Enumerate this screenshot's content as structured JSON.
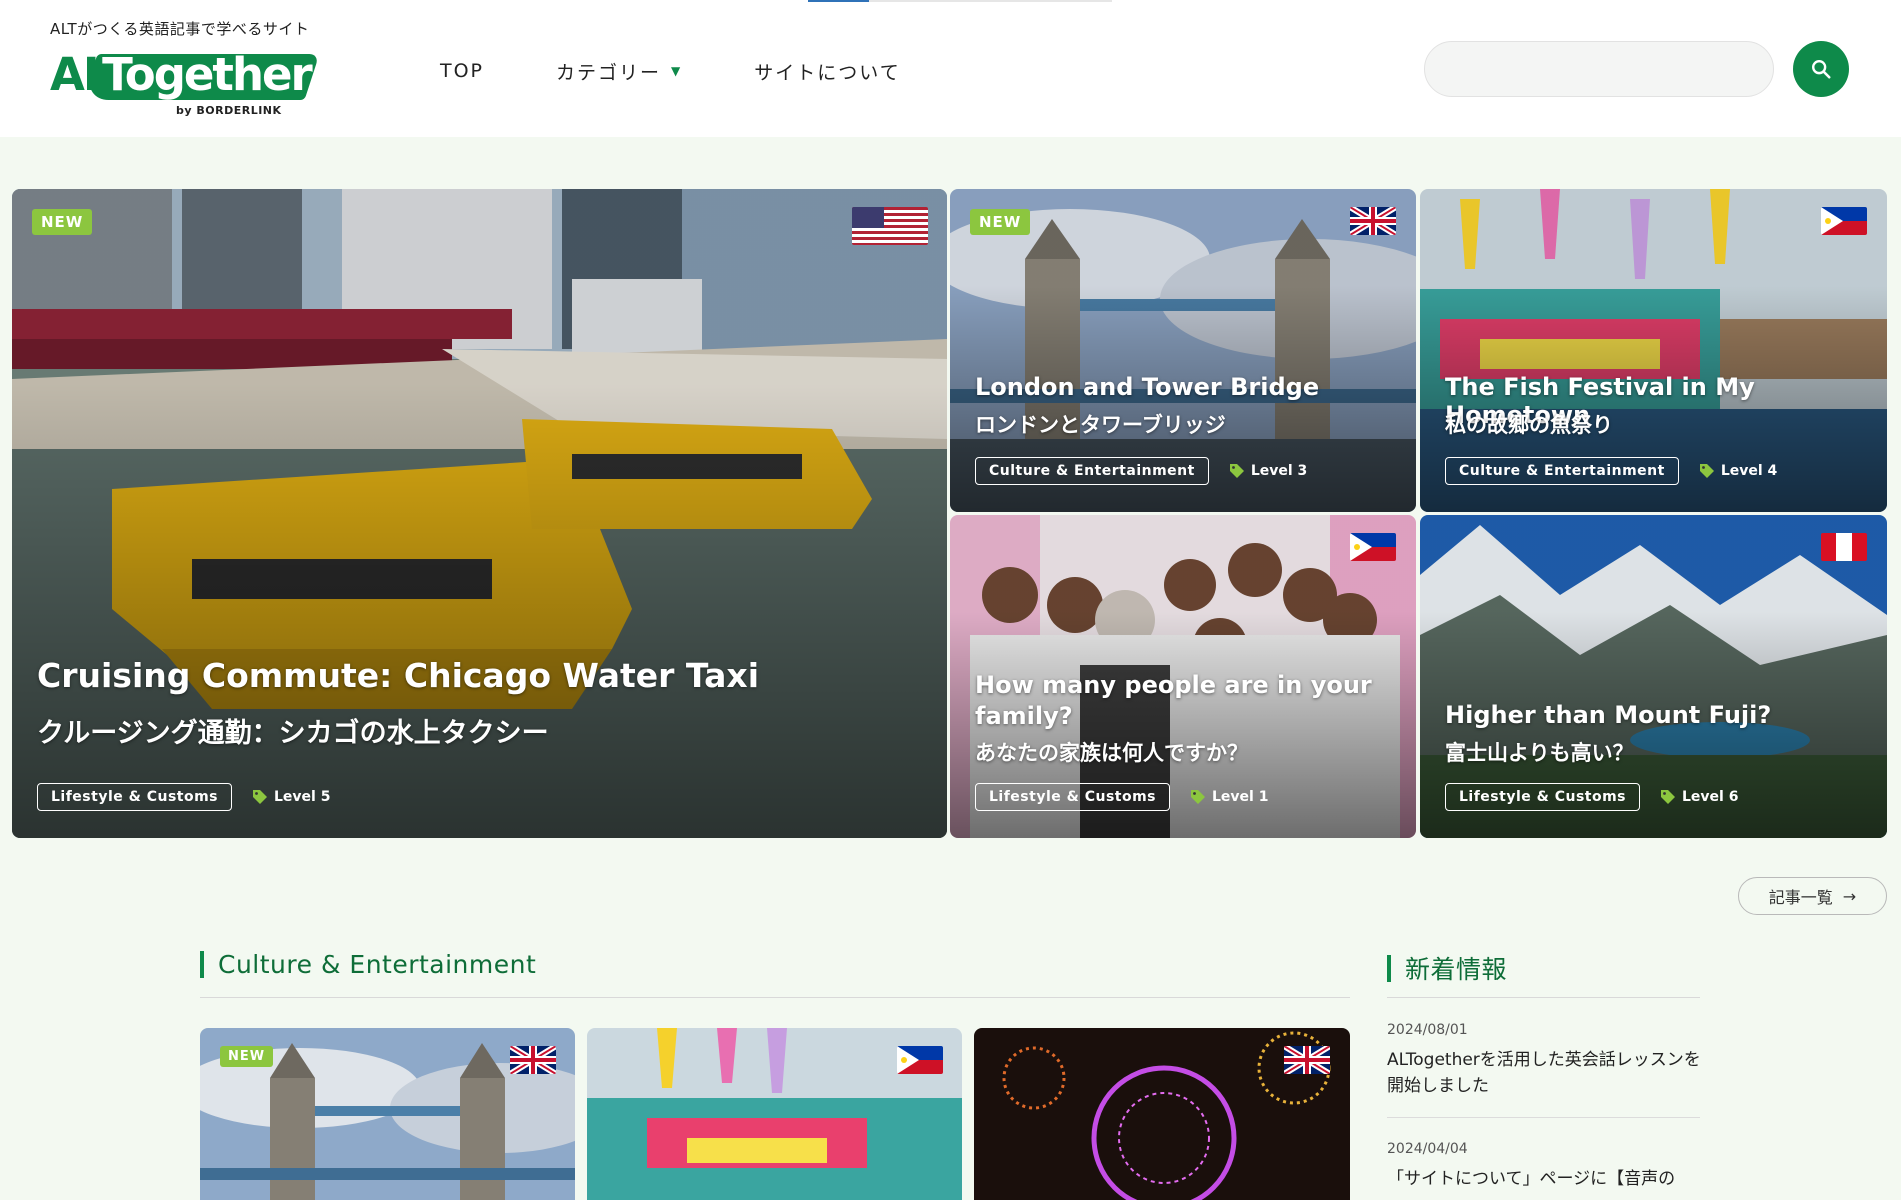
{
  "header": {
    "tagline": "ALTがつくる英語記事で学べるサイト",
    "logo_text_al": "AL",
    "logo_text_rest": "Together",
    "logo_by": "by BORDERLINK",
    "brand_color": "#0e8a4a",
    "nav": [
      {
        "label": "TOP"
      },
      {
        "label": "カテゴリー",
        "has_dropdown": true
      },
      {
        "label": "サイトについて"
      }
    ],
    "caret": "▼",
    "search": {
      "value": "",
      "placeholder": ""
    },
    "search_icon": "search-icon"
  },
  "hero": [
    {
      "badge": "NEW",
      "flag": "us",
      "title_en": "Cruising Commute: Chicago Water Taxi",
      "title_ja": "クルージング通勤：シカゴの水上タクシー",
      "category": "Lifestyle & Customs",
      "level": "Level 5"
    },
    {
      "badge": "NEW",
      "flag": "uk",
      "title_en": "London and Tower Bridge",
      "title_ja": "ロンドンとタワーブリッジ",
      "category": "Culture & Entertainment",
      "level": "Level 3"
    },
    {
      "badge": "",
      "flag": "ph",
      "title_en": "The Fish Festival in My Hometown",
      "title_ja": "私の故郷の魚祭り",
      "category": "Culture & Entertainment",
      "level": "Level 4"
    },
    {
      "badge": "",
      "flag": "ph",
      "title_en_1": "How many people are in your",
      "title_en_2": "family?",
      "title_ja": "あなたの家族は何人ですか？",
      "category": "Lifestyle & Customs",
      "level": "Level 1"
    },
    {
      "badge": "",
      "flag": "pe",
      "title_en": "Higher than Mount Fuji?",
      "title_ja": "富士山よりも高い？",
      "category": "Lifestyle & Customs",
      "level": "Level 6"
    }
  ],
  "more_button": {
    "label": "記事一覧",
    "arrow": "→"
  },
  "culture_section": {
    "title": "Culture & Entertainment",
    "items": [
      {
        "badge": "NEW",
        "flag": "uk"
      },
      {
        "badge": "",
        "flag": "ph"
      },
      {
        "badge": "",
        "flag": "uk"
      }
    ]
  },
  "news_section": {
    "title": "新着情報",
    "items": [
      {
        "date": "2024/08/01",
        "text": "ALTogetherを活用した英会話レッスンを開始しました"
      },
      {
        "date": "2024/04/04",
        "text": "「サイトについて」ページに【音声の"
      }
    ]
  }
}
